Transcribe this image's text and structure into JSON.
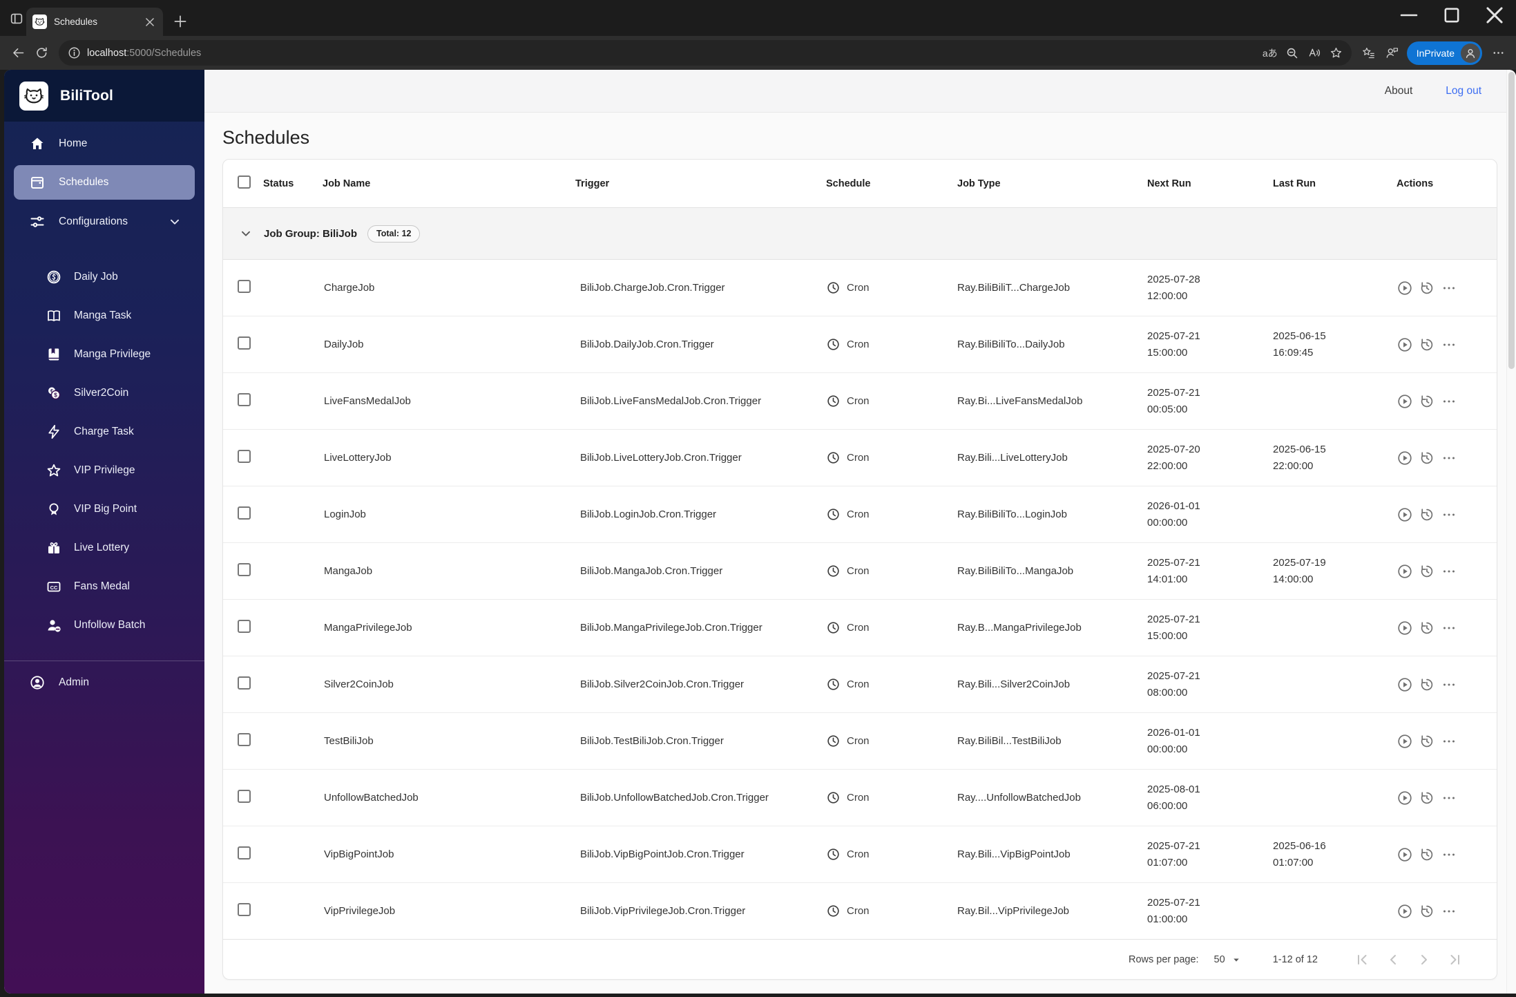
{
  "browser": {
    "tab_title": "Schedules",
    "url_host": "localhost",
    "url_path": ":5000/Schedules",
    "inprivate_label": "InPrivate"
  },
  "header": {
    "about_label": "About",
    "logout_label": "Log out"
  },
  "sidebar": {
    "app_name": "BiliTool",
    "items": [
      {
        "label": "Home",
        "icon": "home-icon",
        "selected": false
      },
      {
        "label": "Schedules",
        "icon": "calendar-icon",
        "selected": true
      },
      {
        "label": "Configurations",
        "icon": "tune-icon",
        "selected": false,
        "expandable": true
      }
    ],
    "config_items": [
      {
        "label": "Daily Job",
        "icon": "coin-dollar-icon"
      },
      {
        "label": "Manga Task",
        "icon": "book-open-icon"
      },
      {
        "label": "Manga Privilege",
        "icon": "book-filled-icon"
      },
      {
        "label": "Silver2Coin",
        "icon": "coins-icon"
      },
      {
        "label": "Charge Task",
        "icon": "bolt-icon"
      },
      {
        "label": "VIP Privilege",
        "icon": "star-outline-icon"
      },
      {
        "label": "VIP Big Point",
        "icon": "medal-icon"
      },
      {
        "label": "Live Lottery",
        "icon": "gift-icon"
      },
      {
        "label": "Fans Medal",
        "icon": "cc-icon"
      },
      {
        "label": "Unfollow Batch",
        "icon": "person-remove-icon"
      }
    ],
    "admin_label": "Admin"
  },
  "page": {
    "title": "Schedules",
    "group_label": "Job Group: BiliJob",
    "group_total_label": "Total: 12"
  },
  "table": {
    "headers": {
      "status": "Status",
      "job_name": "Job Name",
      "trigger": "Trigger",
      "schedule": "Schedule",
      "job_type": "Job Type",
      "next_run": "Next Run",
      "last_run": "Last Run",
      "actions": "Actions"
    },
    "rows": [
      {
        "name": "ChargeJob",
        "trigger": "BiliJob.ChargeJob.Cron.Trigger",
        "schedule": "Cron",
        "job_type": "Ray.BiliBiliT...ChargeJob",
        "next_run_date": "2025-07-28",
        "next_run_time": "12:00:00",
        "last_run_date": "",
        "last_run_time": ""
      },
      {
        "name": "DailyJob",
        "trigger": "BiliJob.DailyJob.Cron.Trigger",
        "schedule": "Cron",
        "job_type": "Ray.BiliBiliTo...DailyJob",
        "next_run_date": "2025-07-21",
        "next_run_time": "15:00:00",
        "last_run_date": "2025-06-15",
        "last_run_time": "16:09:45"
      },
      {
        "name": "LiveFansMedalJob",
        "trigger": "BiliJob.LiveFansMedalJob.Cron.Trigger",
        "schedule": "Cron",
        "job_type": "Ray.Bi...LiveFansMedalJob",
        "next_run_date": "2025-07-21",
        "next_run_time": "00:05:00",
        "last_run_date": "",
        "last_run_time": ""
      },
      {
        "name": "LiveLotteryJob",
        "trigger": "BiliJob.LiveLotteryJob.Cron.Trigger",
        "schedule": "Cron",
        "job_type": "Ray.Bili...LiveLotteryJob",
        "next_run_date": "2025-07-20",
        "next_run_time": "22:00:00",
        "last_run_date": "2025-06-15",
        "last_run_time": "22:00:00"
      },
      {
        "name": "LoginJob",
        "trigger": "BiliJob.LoginJob.Cron.Trigger",
        "schedule": "Cron",
        "job_type": "Ray.BiliBiliTo...LoginJob",
        "next_run_date": "2026-01-01",
        "next_run_time": "00:00:00",
        "last_run_date": "",
        "last_run_time": ""
      },
      {
        "name": "MangaJob",
        "trigger": "BiliJob.MangaJob.Cron.Trigger",
        "schedule": "Cron",
        "job_type": "Ray.BiliBiliTo...MangaJob",
        "next_run_date": "2025-07-21",
        "next_run_time": "14:01:00",
        "last_run_date": "2025-07-19",
        "last_run_time": "14:00:00"
      },
      {
        "name": "MangaPrivilegeJob",
        "trigger": "BiliJob.MangaPrivilegeJob.Cron.Trigger",
        "schedule": "Cron",
        "job_type": "Ray.B...MangaPrivilegeJob",
        "next_run_date": "2025-07-21",
        "next_run_time": "15:00:00",
        "last_run_date": "",
        "last_run_time": ""
      },
      {
        "name": "Silver2CoinJob",
        "trigger": "BiliJob.Silver2CoinJob.Cron.Trigger",
        "schedule": "Cron",
        "job_type": "Ray.Bili...Silver2CoinJob",
        "next_run_date": "2025-07-21",
        "next_run_time": "08:00:00",
        "last_run_date": "",
        "last_run_time": ""
      },
      {
        "name": "TestBiliJob",
        "trigger": "BiliJob.TestBiliJob.Cron.Trigger",
        "schedule": "Cron",
        "job_type": "Ray.BiliBil...TestBiliJob",
        "next_run_date": "2026-01-01",
        "next_run_time": "00:00:00",
        "last_run_date": "",
        "last_run_time": ""
      },
      {
        "name": "UnfollowBatchedJob",
        "trigger": "BiliJob.UnfollowBatchedJob.Cron.Trigger",
        "schedule": "Cron",
        "job_type": "Ray....UnfollowBatchedJob",
        "next_run_date": "2025-08-01",
        "next_run_time": "06:00:00",
        "last_run_date": "",
        "last_run_time": ""
      },
      {
        "name": "VipBigPointJob",
        "trigger": "BiliJob.VipBigPointJob.Cron.Trigger",
        "schedule": "Cron",
        "job_type": "Ray.Bili...VipBigPointJob",
        "next_run_date": "2025-07-21",
        "next_run_time": "01:07:00",
        "last_run_date": "2025-06-16",
        "last_run_time": "01:07:00"
      },
      {
        "name": "VipPrivilegeJob",
        "trigger": "BiliJob.VipPrivilegeJob.Cron.Trigger",
        "schedule": "Cron",
        "job_type": "Ray.Bil...VipPrivilegeJob",
        "next_run_date": "2025-07-21",
        "next_run_time": "01:00:00",
        "last_run_date": "",
        "last_run_time": ""
      }
    ]
  },
  "pagination": {
    "rows_per_page_label": "Rows per page:",
    "rows_per_page_value": "50",
    "range_label": "1-12 of 12"
  },
  "colors": {
    "status_ok": "#46a546",
    "accent_link": "#3d6ef2",
    "inprivate_badge": "#0f74d4",
    "sidebar_selected": "#7f89b6",
    "sidebar_top": "#152453",
    "sidebar_bottom": "#420f55"
  }
}
